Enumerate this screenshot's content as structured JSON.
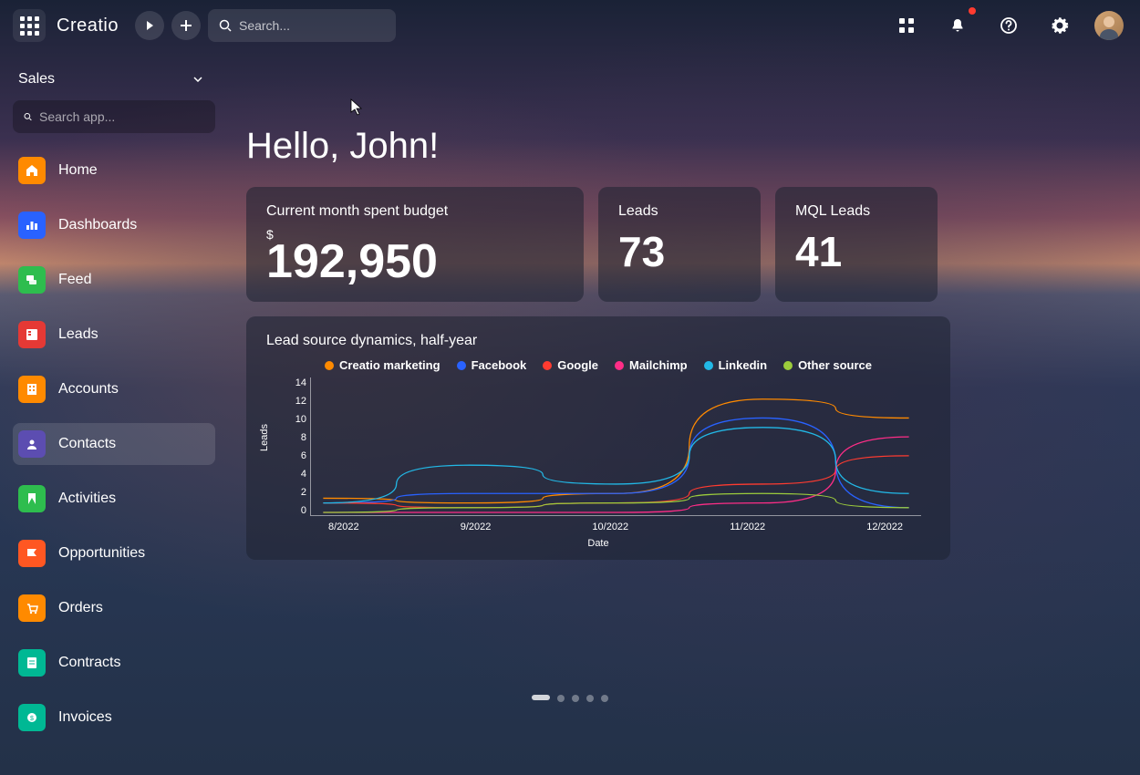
{
  "brand": "Creatio",
  "search": {
    "placeholder": "Search..."
  },
  "module": {
    "name": "Sales"
  },
  "app_search": {
    "placeholder": "Search app..."
  },
  "nav": [
    {
      "label": "Home",
      "color": "#ff8a00"
    },
    {
      "label": "Dashboards",
      "color": "#2962ff"
    },
    {
      "label": "Feed",
      "color": "#2ebd4e"
    },
    {
      "label": "Leads",
      "color": "#e53935"
    },
    {
      "label": "Accounts",
      "color": "#ff8a00"
    },
    {
      "label": "Contacts",
      "color": "#5c4db1",
      "active": true
    },
    {
      "label": "Activities",
      "color": "#2ebd4e"
    },
    {
      "label": "Opportunities",
      "color": "#ff5722"
    },
    {
      "label": "Orders",
      "color": "#ff8a00"
    },
    {
      "label": "Contracts",
      "color": "#00b894"
    },
    {
      "label": "Invoices",
      "color": "#00b894"
    }
  ],
  "greeting": "Hello, John!",
  "kpis": {
    "budget": {
      "title": "Current month spent budget",
      "currency": "$",
      "value": "192,950"
    },
    "leads": {
      "title": "Leads",
      "value": "73"
    },
    "mql": {
      "title": "MQL Leads",
      "value": "41"
    }
  },
  "chart_title": "Lead source dynamics, half-year",
  "chart_data": {
    "type": "line",
    "xlabel": "Date",
    "ylabel": "Leads",
    "ylim": [
      0,
      14
    ],
    "y_ticks": [
      0,
      2,
      4,
      6,
      8,
      10,
      12,
      14
    ],
    "categories": [
      "8/2022",
      "9/2022",
      "10/2022",
      "11/2022",
      "12/2022"
    ],
    "series": [
      {
        "name": "Creatio marketing",
        "color": "#ff8a00",
        "values": [
          1.5,
          1,
          2,
          12,
          10
        ]
      },
      {
        "name": "Facebook",
        "color": "#2962ff",
        "values": [
          1,
          2,
          2,
          10,
          0.5
        ]
      },
      {
        "name": "Google",
        "color": "#ff3b30",
        "values": [
          1,
          0.5,
          1,
          3,
          6
        ]
      },
      {
        "name": "Mailchimp",
        "color": "#ff2d87",
        "values": [
          0,
          0,
          0,
          1,
          8
        ]
      },
      {
        "name": "Linkedin",
        "color": "#22b8e6",
        "values": [
          1,
          5,
          3,
          9,
          2
        ]
      },
      {
        "name": "Other source",
        "color": "#9ccc3c",
        "values": [
          0,
          0.5,
          1,
          2,
          0.5
        ]
      }
    ]
  }
}
